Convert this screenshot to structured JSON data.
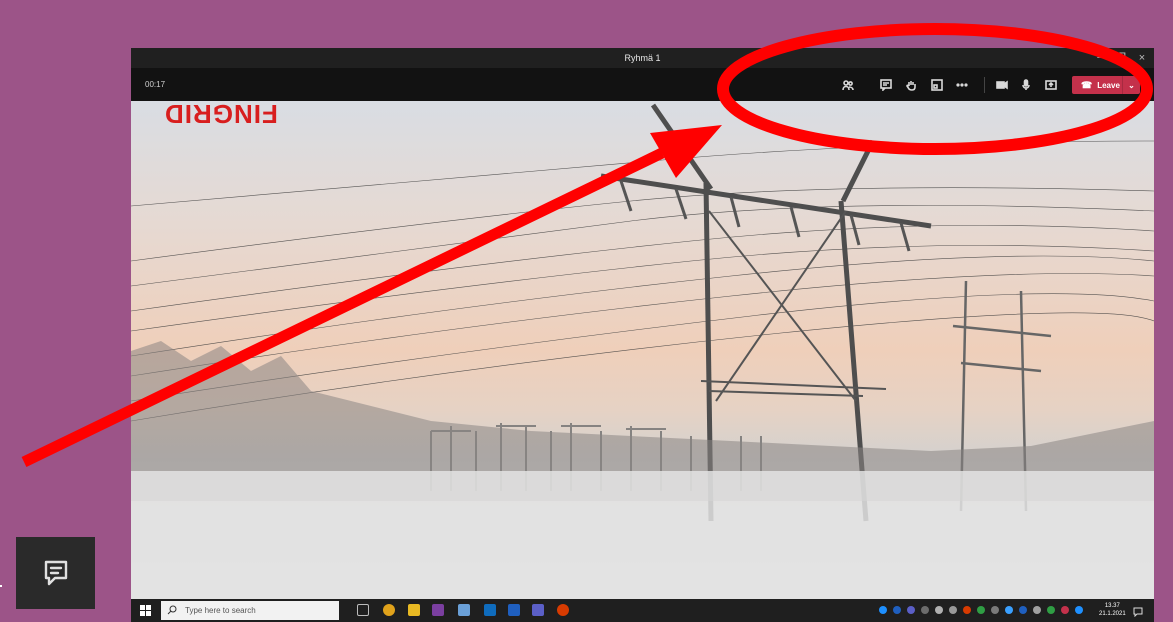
{
  "window": {
    "title": "Ryhmä 1",
    "controls": [
      "−",
      "❐",
      "×"
    ]
  },
  "meeting": {
    "timer": "00:17",
    "leave_label": "Leave",
    "toolbar_icons": [
      "people-icon",
      "chat-icon",
      "raise-hand-icon",
      "breakout-rooms-icon",
      "more-options-icon",
      "camera-icon",
      "microphone-icon",
      "share-screen-icon"
    ]
  },
  "video": {
    "logo_text": "FINGRID"
  },
  "taskbar": {
    "search_placeholder": "Type here to search",
    "time": "13.37",
    "date": "21.1.2021"
  },
  "colors": {
    "background": "#9c5488",
    "leave_button": "#c4314b",
    "annotation_red": "#ff0000"
  }
}
